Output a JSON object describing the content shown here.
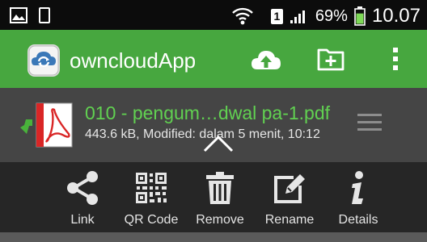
{
  "status_bar": {
    "icons": [
      "picture-icon",
      "sim-card-icon",
      "wifi-icon",
      "sim-1-icon",
      "signal-icon",
      "battery-icon"
    ],
    "sim_label": "1",
    "battery_percent": "69%",
    "battery_level": 0.69,
    "time": "10.07"
  },
  "app_bar": {
    "title": "owncloudApp",
    "actions": [
      "upload-icon",
      "new-folder-icon",
      "overflow-menu-icon"
    ]
  },
  "file": {
    "name": "010 - pengum…dwal pa-1.pdf",
    "meta": "443.6 kB, Modified: dalam 5 menit, 10:12",
    "type_icon": "pdf-icon",
    "status_icon": "download-arrow-icon"
  },
  "actions": [
    {
      "label": "Link",
      "icon": "share-icon"
    },
    {
      "label": "QR Code",
      "icon": "qr-code-icon"
    },
    {
      "label": "Remove",
      "icon": "trash-icon"
    },
    {
      "label": "Rename",
      "icon": "edit-icon"
    },
    {
      "label": "Details",
      "icon": "info-icon"
    }
  ],
  "colors": {
    "app_bar": "#47a73f",
    "file_name": "#61d151",
    "file_row": "#454545",
    "action_bar": "#262626"
  }
}
